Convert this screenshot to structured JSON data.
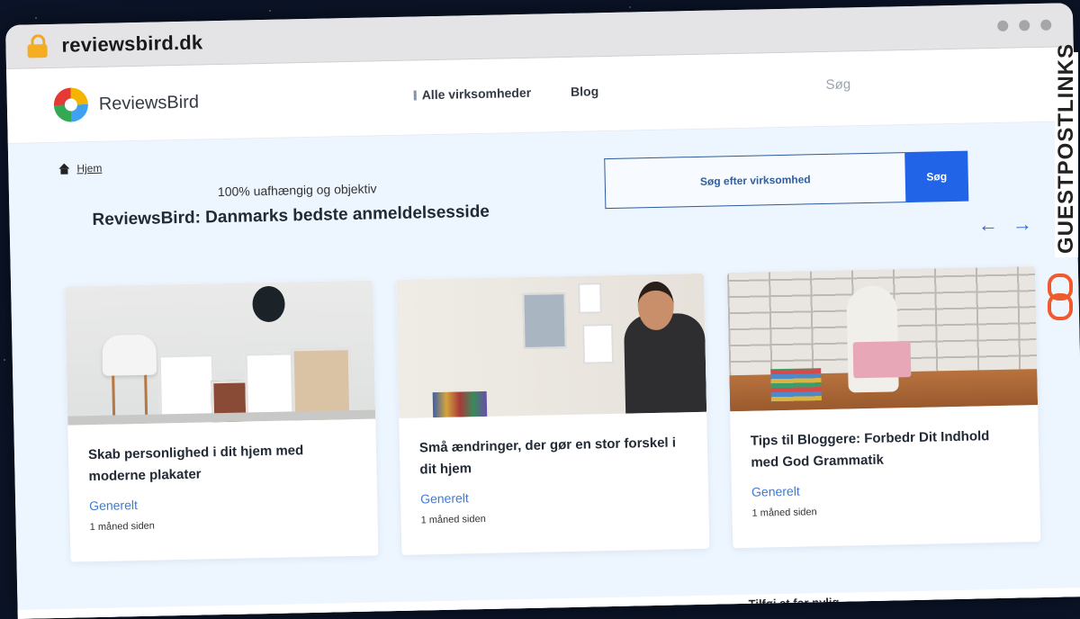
{
  "browser": {
    "url": "reviewsbird.dk"
  },
  "header": {
    "logo_text": "ReviewsBird",
    "nav": [
      {
        "label": "Alle virksomheder"
      },
      {
        "label": "Blog"
      }
    ],
    "search_label": "Søg"
  },
  "hero": {
    "breadcrumb_home": "Hjem",
    "tagline": "100% uafhængig og objektiv",
    "title": "ReviewsBird: Danmarks bedste anmeldelsesside",
    "search_placeholder": "Søg efter virksomhed",
    "search_button": "Søg",
    "prev_arrow": "←",
    "next_arrow": "→"
  },
  "cards": [
    {
      "title": "Skab personlighed i dit hjem med moderne plakater",
      "category": "Generelt",
      "time": "1 måned siden"
    },
    {
      "title": "Små ændringer, der gør en stor forskel i dit hjem",
      "category": "Generelt",
      "time": "1 måned siden"
    },
    {
      "title": "Tips til Bloggere: Forbedr Dit Indhold med God Grammatik",
      "category": "Generelt",
      "time": "1 måned siden"
    }
  ],
  "footer_partial": "Tilføj et for nylig",
  "watermark": "GUESTPOSTLINKS",
  "colors": {
    "accent": "#2164e8",
    "link": "#3f7ad0",
    "hero_bg": "#edf5fe",
    "watermark_icon": "#ef5a2e"
  }
}
